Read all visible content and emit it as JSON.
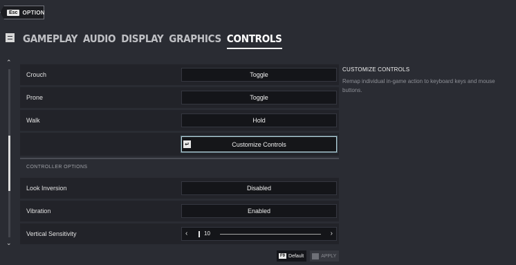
{
  "topbar": {
    "esc_key": "Esc",
    "title": "OPTIONS"
  },
  "tabs": [
    {
      "label": "GAMEPLAY",
      "active": false
    },
    {
      "label": "AUDIO",
      "active": false
    },
    {
      "label": "DISPLAY",
      "active": false
    },
    {
      "label": "GRAPHICS",
      "active": false
    },
    {
      "label": "CONTROLS",
      "active": true
    }
  ],
  "settings": {
    "crouch": {
      "label": "Crouch",
      "value": "Toggle"
    },
    "prone": {
      "label": "Prone",
      "value": "Toggle"
    },
    "walk": {
      "label": "Walk",
      "value": "Hold"
    },
    "customize": {
      "label": "Customize Controls"
    },
    "controller_section": "CONTROLLER OPTIONS",
    "look_inversion": {
      "label": "Look Inversion",
      "value": "Disabled"
    },
    "vibration": {
      "label": "Vibration",
      "value": "Enabled"
    },
    "vertical_sensitivity": {
      "label": "Vertical Sensitivity",
      "value": "10"
    }
  },
  "info": {
    "title": "CUSTOMIZE CONTROLS",
    "description": "Remap individual in-game action to keyboard keys and mouse buttons."
  },
  "footer": {
    "default_key": "F9",
    "default_label": "Default",
    "apply_label": "APPLY"
  },
  "icons": {
    "back": "chevron-left-icon",
    "menu": "menu-icon",
    "enter": "enter-key-icon",
    "scroll_up": "chevron-up-icon",
    "scroll_down": "chevron-down-icon"
  },
  "colors": {
    "background": "#2a2c33",
    "row": "#222329",
    "highlight": "#b4d0da"
  }
}
